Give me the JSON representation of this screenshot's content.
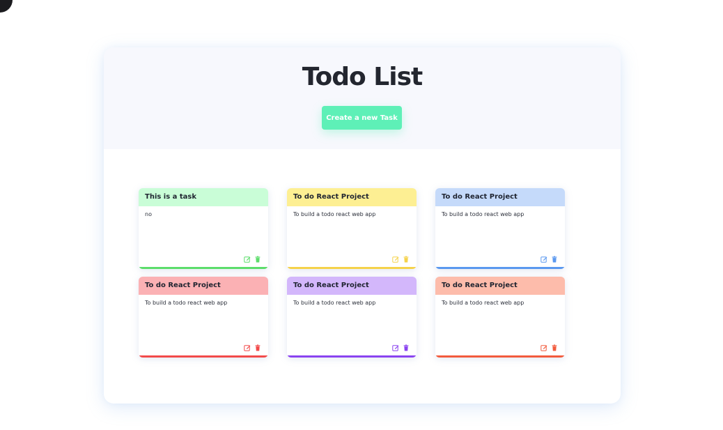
{
  "header": {
    "title": "Todo List",
    "create_button_label": "Create a new Task"
  },
  "colors": {
    "create_button": "#5ef0b7"
  },
  "tasks": [
    {
      "title": "This is a task",
      "description": "no",
      "head_color": "#c9fdd7",
      "accent": "#5cdd6b",
      "icons": [
        "edit-icon",
        "delete-icon"
      ]
    },
    {
      "title": "To do React Project",
      "description": "To build a todo react web app",
      "head_color": "#fdef93",
      "accent": "#f5d24a",
      "icons": [
        "edit-icon",
        "delete-icon"
      ]
    },
    {
      "title": "To do React Project",
      "description": "To build a todo react web app",
      "head_color": "#c5dafa",
      "accent": "#5a98ef",
      "icons": [
        "edit-icon",
        "delete-icon"
      ]
    },
    {
      "title": "To do React Project",
      "description": "To build a todo react web app",
      "head_color": "#fbb1b4",
      "accent": "#f24a4a",
      "icons": [
        "edit-icon",
        "delete-icon"
      ]
    },
    {
      "title": "To do React Project",
      "description": "To build a todo react web app",
      "head_color": "#d3b7fb",
      "accent": "#8a43f0",
      "icons": [
        "edit-icon",
        "delete-icon"
      ]
    },
    {
      "title": "To do React Project",
      "description": "To build a todo react web app",
      "head_color": "#fdbcab",
      "accent": "#f25b3d",
      "icons": [
        "edit-icon",
        "delete-icon"
      ]
    }
  ]
}
